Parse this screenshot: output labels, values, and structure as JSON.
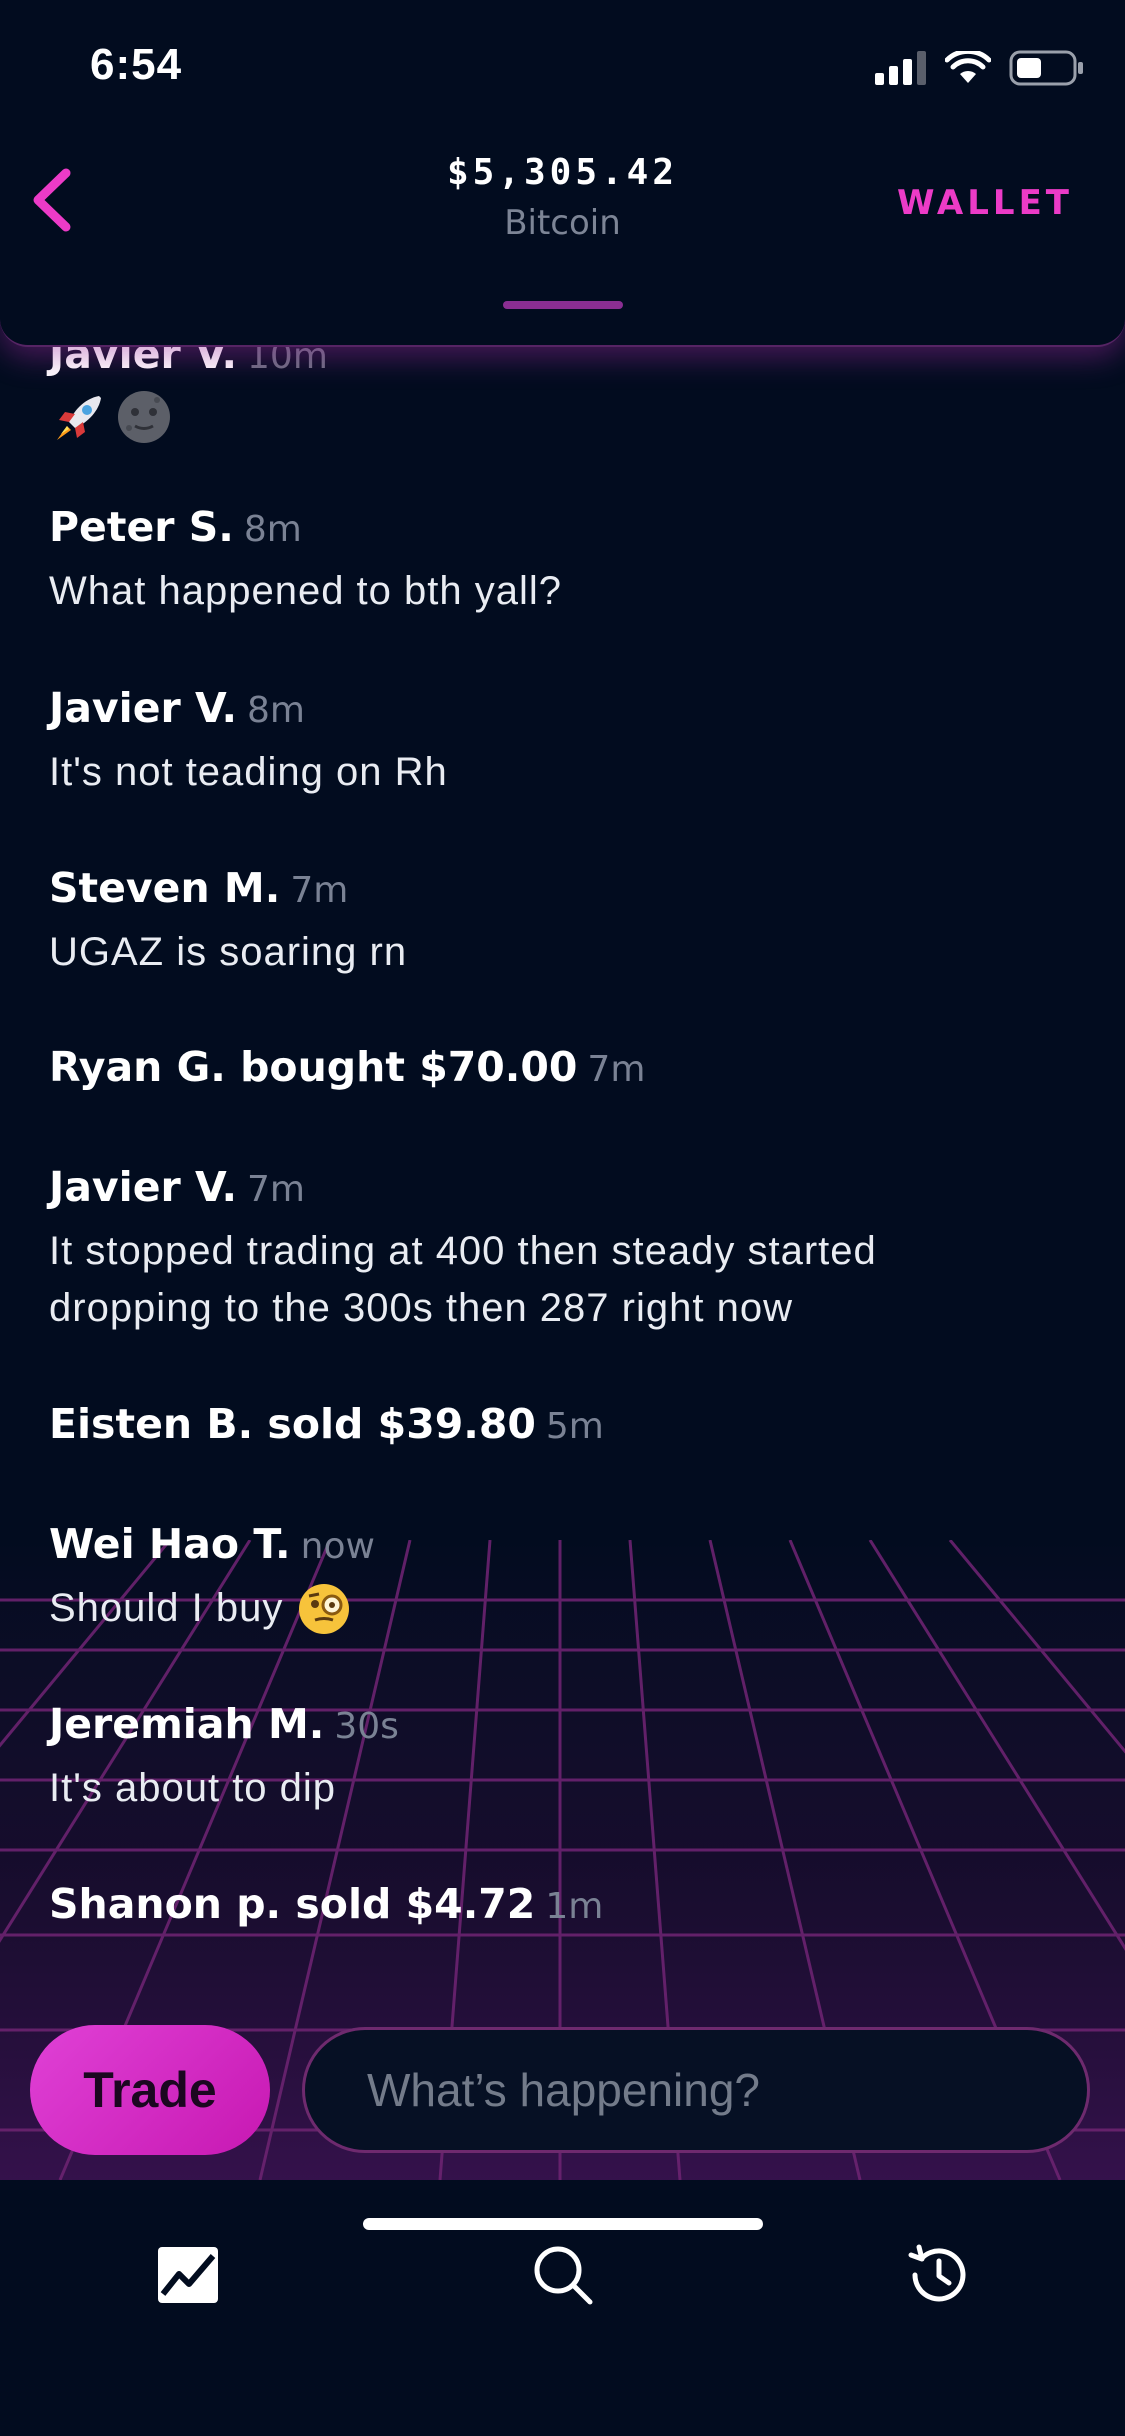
{
  "status_bar": {
    "time": "6:54"
  },
  "header": {
    "price": "$5,305.42",
    "asset": "Bitcoin",
    "wallet_label": "WALLET"
  },
  "partial_message": {
    "name": "Javier V.",
    "time": "10m"
  },
  "messages": [
    {
      "name": "Peter S.",
      "time": "8m",
      "text": "What happened to bth yall?"
    },
    {
      "name": "Javier V.",
      "time": "8m",
      "text": "It's not teading on Rh"
    },
    {
      "name": "Steven M.",
      "time": "7m",
      "text": "UGAZ is soaring rn"
    },
    {
      "name": "Ryan G. bought $70.00",
      "time": "7m"
    },
    {
      "name": "Javier V.",
      "time": "7m",
      "text_line1": "It stopped trading at 400 then steady started",
      "text_line2": "dropping to the 300s then 287 right now"
    },
    {
      "name": "Eisten B. sold $39.80",
      "time": "5m"
    },
    {
      "name": "Wei Hao T.",
      "time": "now",
      "text": "Should I buy"
    },
    {
      "name": "Jeremiah M.",
      "time": "30s",
      "text": "It's about to dip"
    },
    {
      "name": "Shanon p. sold $4.72",
      "time": "1m"
    }
  ],
  "compose": {
    "trade_label": "Trade",
    "placeholder": "What’s happening?"
  },
  "tabbar": {
    "items": [
      {
        "icon": "chart-icon"
      },
      {
        "icon": "search-icon"
      },
      {
        "icon": "history-icon"
      }
    ]
  },
  "colors": {
    "accent": "#ec3bc7",
    "background": "#020c1f",
    "grid": "#5a1e66"
  }
}
